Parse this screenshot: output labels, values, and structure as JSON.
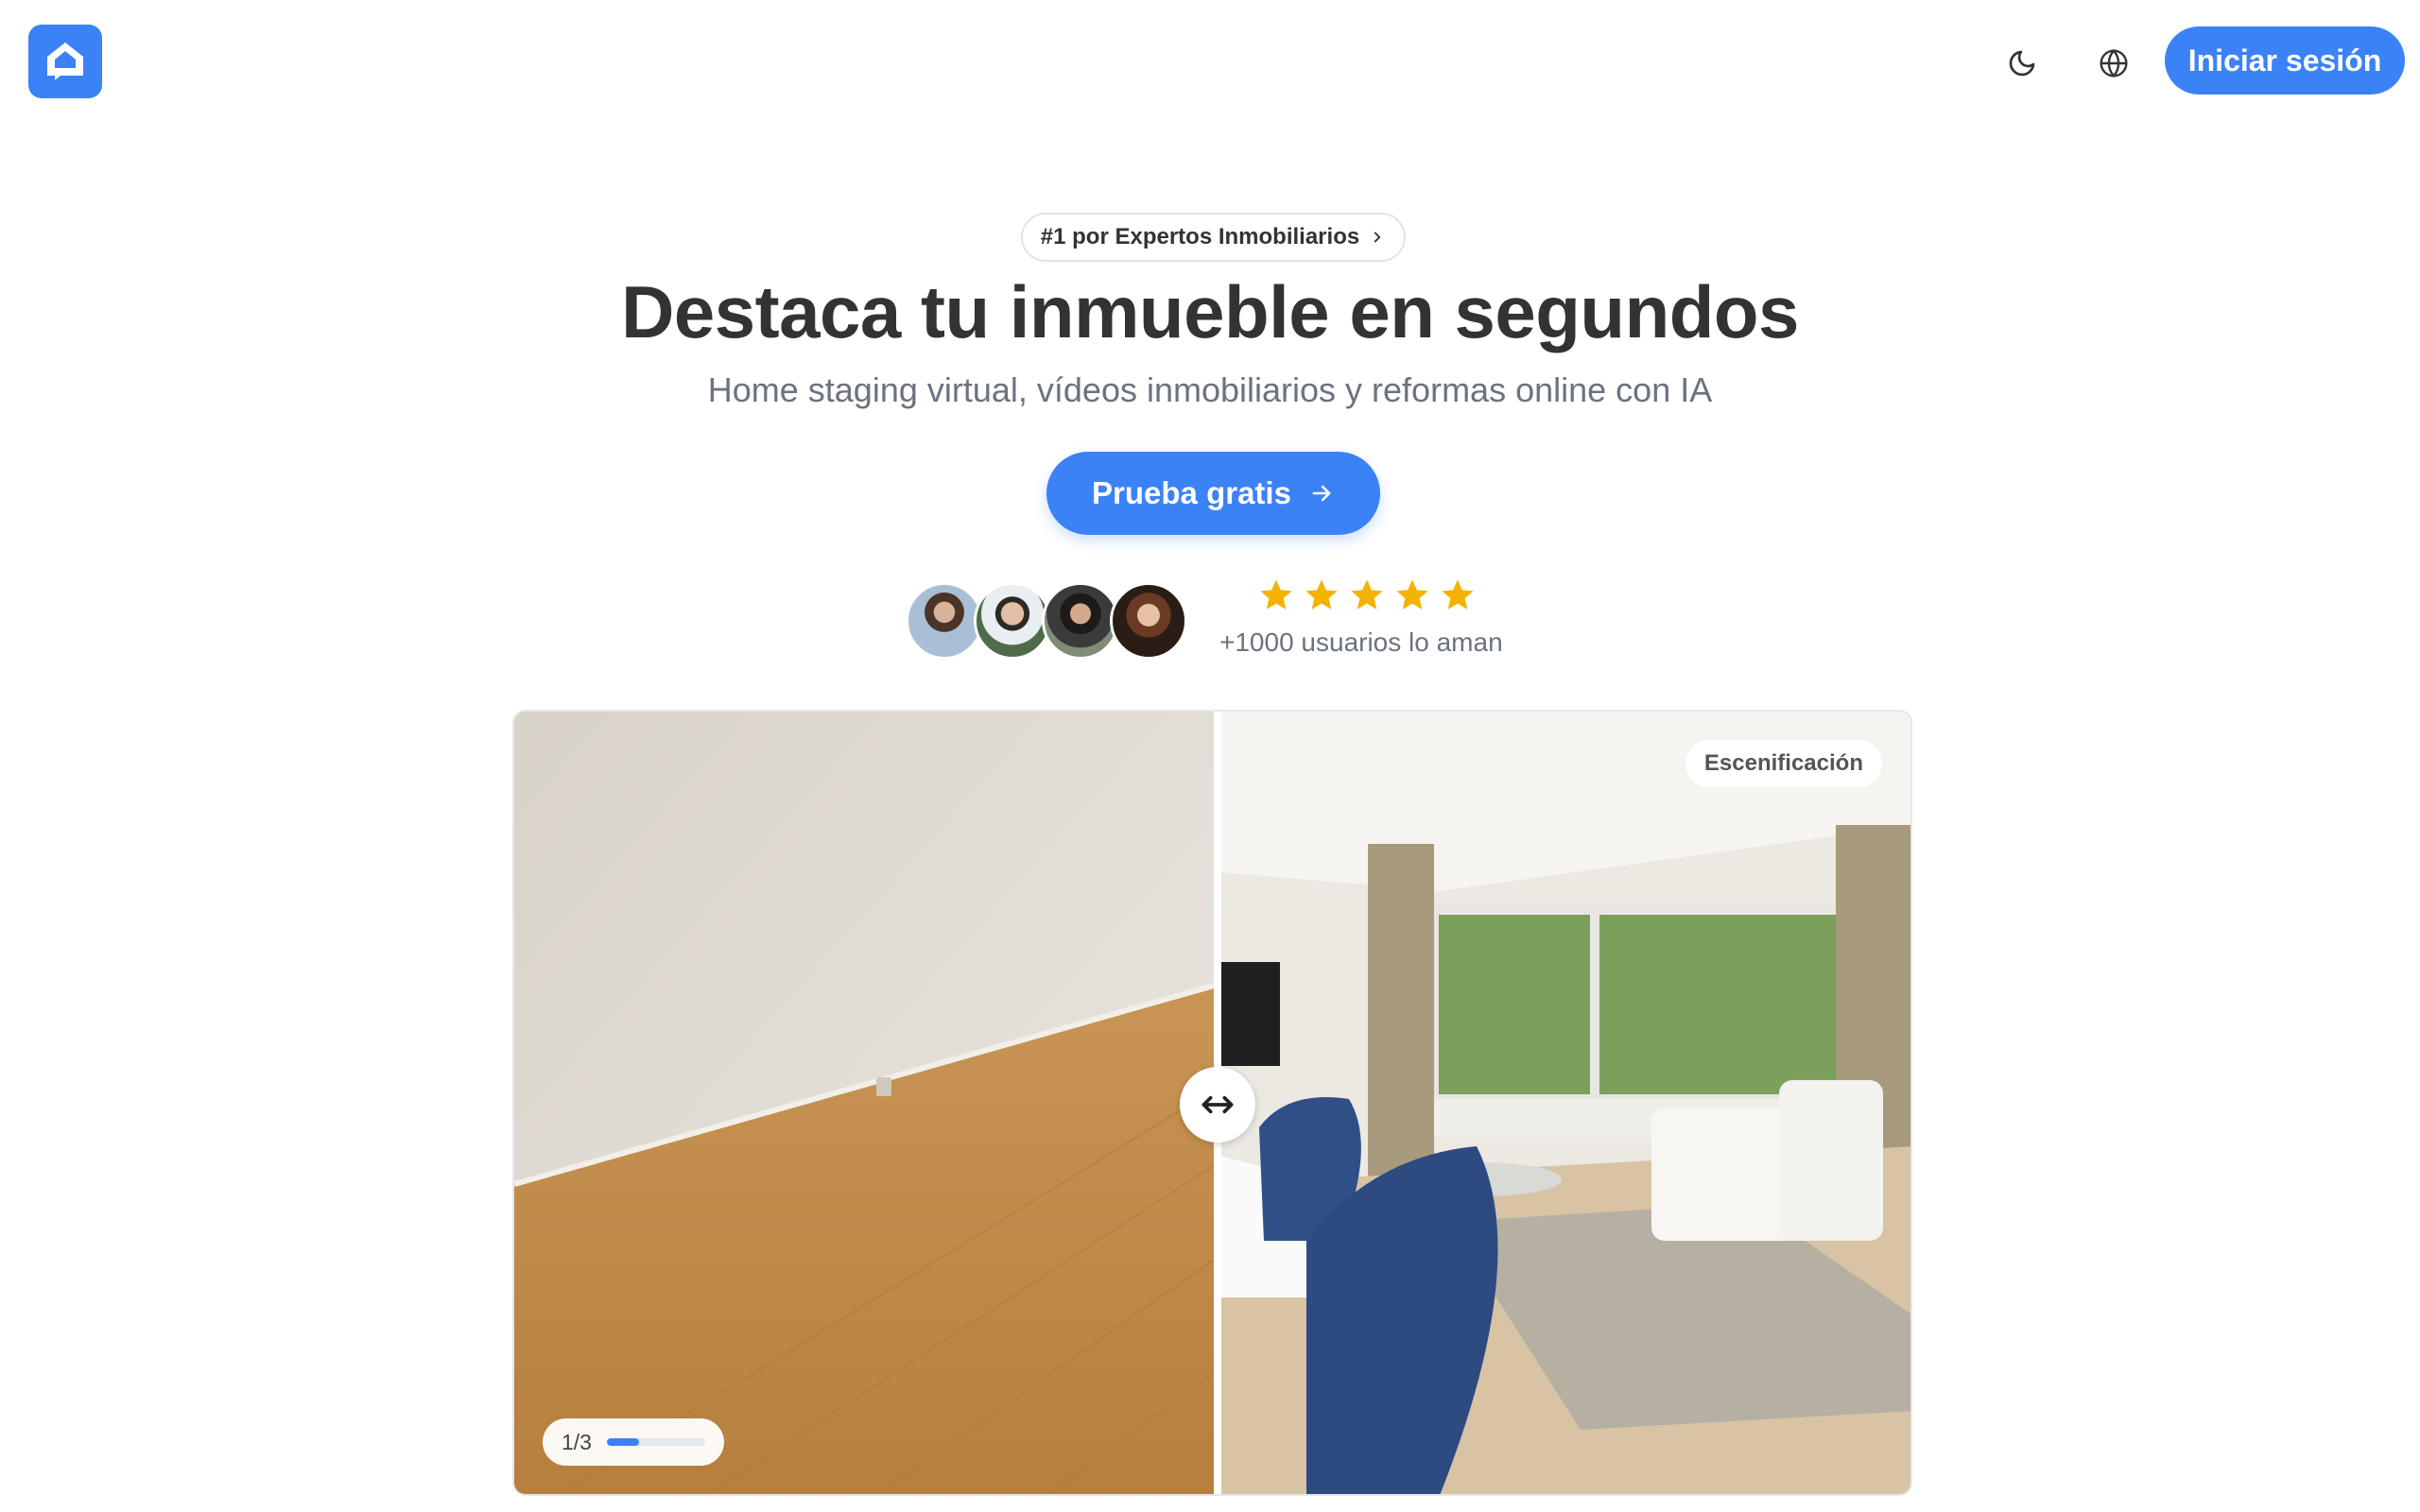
{
  "header": {
    "login_label": "Iniciar sesión",
    "logo_icon": "house-logo-icon",
    "theme_icon": "moon-icon",
    "language_icon": "globe-icon"
  },
  "hero": {
    "badge": "#1 por Expertos Inmobiliarios",
    "title": "Destaca tu inmueble en segundos",
    "subtitle": "Home staging virtual, vídeos inmobiliarios y reformas online con IA",
    "cta_label": "Prueba gratis"
  },
  "social_proof": {
    "rating_stars": 5,
    "text": "+1000 usuarios lo aman"
  },
  "comparison": {
    "tag": "Escenificación",
    "counter": "1/3",
    "progress": 0.33
  },
  "colors": {
    "accent": "#3b82f6",
    "star": "#f5b301"
  }
}
